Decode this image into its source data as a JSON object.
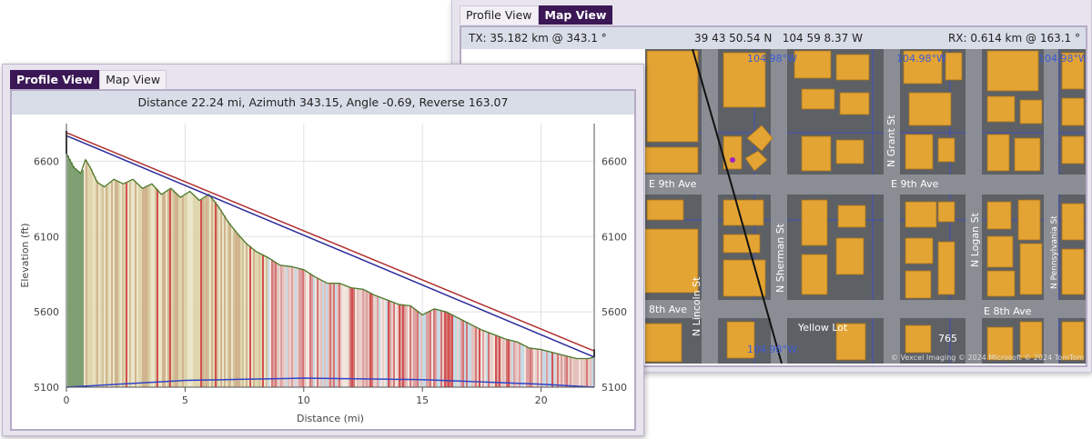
{
  "map_window": {
    "tabs": [
      {
        "label": "Profile View",
        "active": false
      },
      {
        "label": "Map View",
        "active": true
      }
    ],
    "tx": "TX: 35.182 km @ 343.1 °",
    "latlon": "39 43 50.54 N   104 59 8.37 W",
    "rx": "RX: 0.614 km @ 163.1 °",
    "streets": [
      "E 9th Ave",
      "E 9th Ave",
      "E 8th Ave",
      "8th Ave",
      "N Lincoln St",
      "N Sherman St",
      "N Grant St",
      "N Logan St",
      "N Pennsylvania St"
    ],
    "places": [
      "Yellow Lot"
    ],
    "labels": [
      "104.98°W",
      "104.98°W",
      "104.98°W",
      "104.98°W",
      "765"
    ],
    "attribution": "© Vexcel Imaging © 2024 Microsoft © 2024 TomTom"
  },
  "profile_window": {
    "tabs": [
      {
        "label": "Profile View",
        "active": true
      },
      {
        "label": "Map View",
        "active": false
      }
    ],
    "summary": "Distance 22.24 mi, Azimuth 343.15, Angle -0.69, Reverse 163.07"
  },
  "colors": {
    "tab_active": "#3b1855",
    "terrain_line": "#4a7a2a",
    "los_red": "#b03030",
    "los_blue": "#2a2a9a",
    "fresnel": "#2f44c8"
  },
  "chart_data": {
    "type": "area",
    "xlabel": "Distance (mi)",
    "ylabel": "Elevation (ft)",
    "xlim": [
      0,
      22.24
    ],
    "ylim": [
      5100,
      6850
    ],
    "xticks": [
      0,
      5,
      10,
      15,
      20
    ],
    "yticks": [
      5100,
      5600,
      6100,
      6600
    ],
    "grid": true,
    "series": [
      {
        "kind": "terrain",
        "x": [
          0,
          0.3,
          0.6,
          0.8,
          1.0,
          1.3,
          1.6,
          2.0,
          2.4,
          2.8,
          3.2,
          3.6,
          4.0,
          4.4,
          4.8,
          5.2,
          5.6,
          6.0,
          6.4,
          6.8,
          7.2,
          7.6,
          8.0,
          8.5,
          9.0,
          9.5,
          10.0,
          10.5,
          11.0,
          11.5,
          12.0,
          12.5,
          13.0,
          13.5,
          14.0,
          14.5,
          15.0,
          15.5,
          16.0,
          16.5,
          17.0,
          17.5,
          18.0,
          18.5,
          19.0,
          19.5,
          20.0,
          20.5,
          21.0,
          21.5,
          22.0,
          22.24
        ],
        "y": [
          6650,
          6560,
          6520,
          6610,
          6560,
          6460,
          6430,
          6480,
          6450,
          6480,
          6420,
          6450,
          6380,
          6420,
          6360,
          6400,
          6340,
          6380,
          6300,
          6200,
          6120,
          6050,
          6000,
          5960,
          5910,
          5900,
          5880,
          5830,
          5790,
          5790,
          5760,
          5750,
          5710,
          5680,
          5650,
          5640,
          5580,
          5620,
          5600,
          5560,
          5520,
          5480,
          5450,
          5420,
          5400,
          5360,
          5350,
          5330,
          5310,
          5290,
          5290,
          5300
        ]
      },
      {
        "kind": "los-red",
        "x": [
          0,
          22.24
        ],
        "y": [
          6790,
          5340
        ]
      },
      {
        "kind": "los-blue",
        "x": [
          0,
          22.24
        ],
        "y": [
          6770,
          5300
        ]
      },
      {
        "kind": "fresnel",
        "x": [
          0,
          5,
          10,
          15,
          20,
          22.24
        ],
        "y": [
          5100,
          5145,
          5160,
          5150,
          5120,
          5100
        ]
      }
    ]
  }
}
